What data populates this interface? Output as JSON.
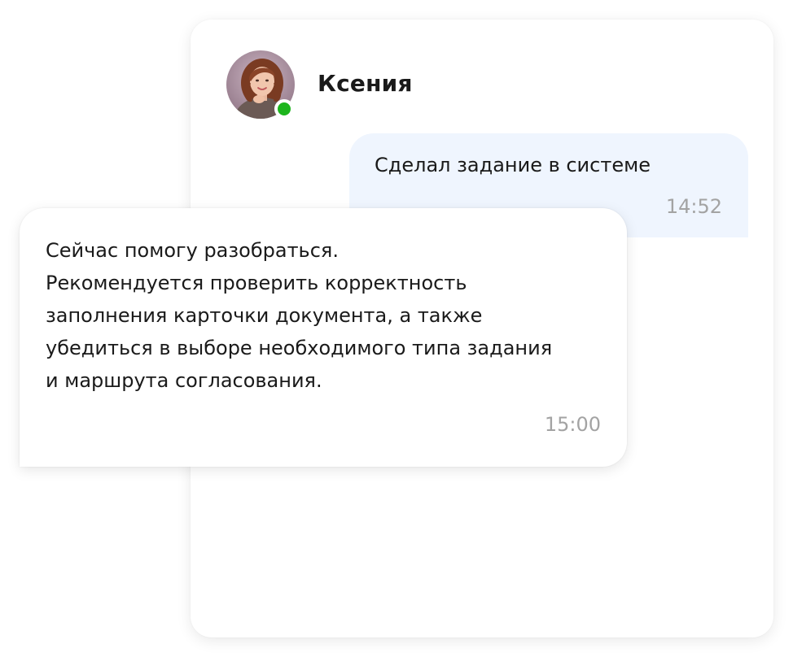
{
  "contact": {
    "name": "Ксения",
    "status_color": "#1db51d"
  },
  "messages": [
    {
      "direction": "outgoing",
      "text": "Сделал задание в системе",
      "time": "14:52"
    },
    {
      "direction": "incoming",
      "lines": [
        "Сейчас помогу разобраться.",
        "Рекомендуется проверить корректность",
        "заполнения карточки документа, а также",
        "убедиться в выборе необходимого типа задания",
        "и маршрута согласования."
      ],
      "time": "15:00"
    }
  ],
  "colors": {
    "outgoing_bubble": "#eff5fe",
    "timestamp": "#a3a3a3",
    "text": "#1a1a1a"
  }
}
